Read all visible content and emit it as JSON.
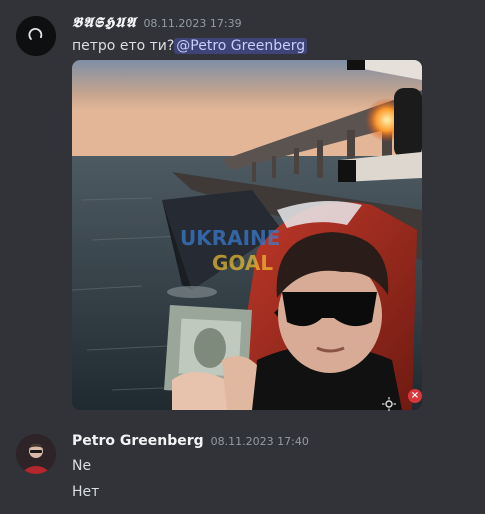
{
  "messages": [
    {
      "username": "𝕭𝕬𝕾𝕳𝖀𝕬",
      "timestamp": "08.11.2023 17:39",
      "text": "петро ето ти?",
      "mention": "@Petro  Greenberg",
      "attachment": {
        "overlay_text_1": "UKRAINE",
        "overlay_text_2": "GOAL"
      }
    },
    {
      "username": "Petro  Greenberg",
      "timestamp": "08.11.2023 17:40",
      "lines": [
        "Ne",
        "Нет"
      ]
    }
  ],
  "icons": {
    "remove": "×"
  },
  "colors": {
    "background": "#313338",
    "mention_bg": "#5865f2",
    "danger": "#da373c"
  }
}
